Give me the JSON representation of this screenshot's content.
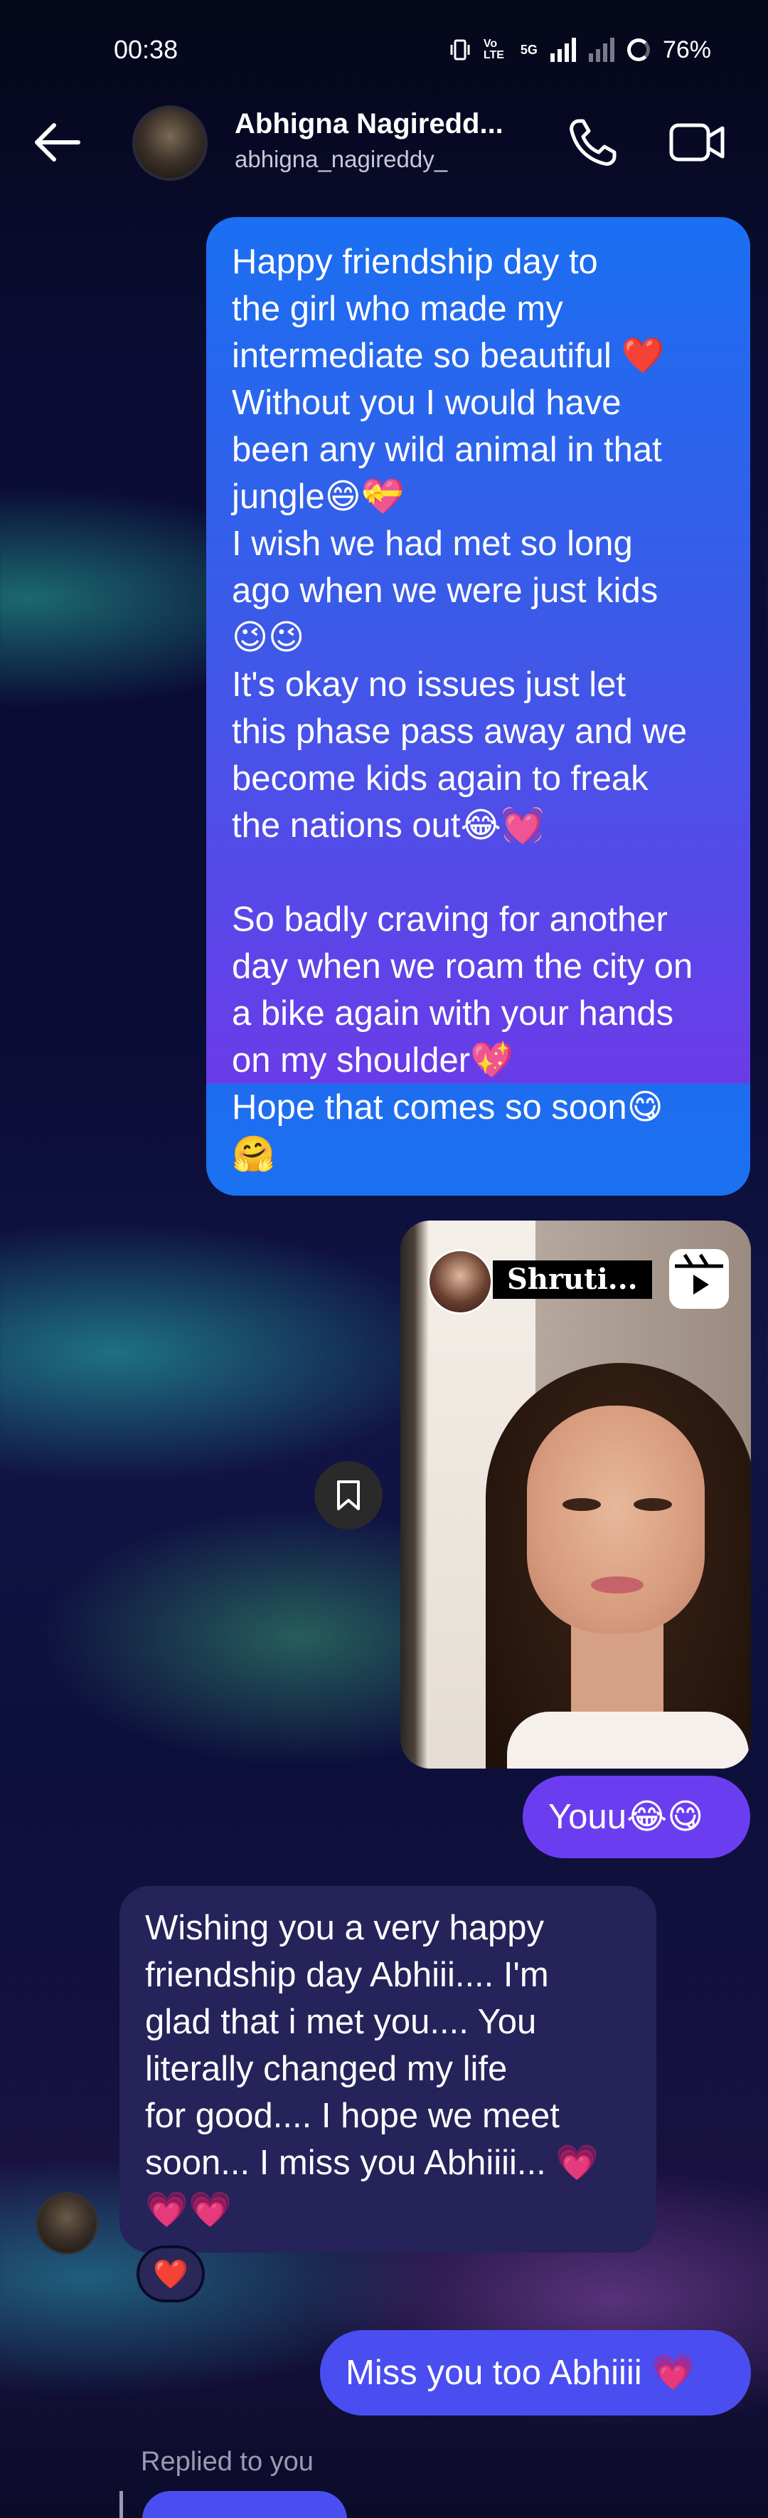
{
  "status_bar": {
    "time": "00:38",
    "volte_label": "Vo LTE",
    "network": "5G",
    "battery": "76%"
  },
  "header": {
    "name": "Abhigna Nagiredd...",
    "username": "abhigna_nagireddy_",
    "icons": [
      "back-arrow-icon",
      "phone-icon",
      "video-icon"
    ]
  },
  "messages": {
    "friendship_message": {
      "lines": [
        "Happy friendship day to",
        "the girl who made my",
        "intermediate so beautiful ❤️",
        "Without you I would have",
        "been any wild animal in that",
        "jungle😄💝",
        "I wish we had met so long",
        "ago when we were just kids",
        "😉😉",
        "It's okay no issues just let",
        "this phase pass away and we",
        "become kids again to freak",
        "the nations out😂💓",
        "So badly craving for another",
        "day when we roam the city on",
        "a bike again with your hands",
        "on my shoulder💖",
        "Hope that comes so soon😋",
        "🤗"
      ]
    },
    "reel": {
      "creator_name": "Shruti...",
      "icon": "reels-icon"
    },
    "youu": "Youu😂😋",
    "wishing_message": {
      "lines": [
        "Wishing you a very happy",
        "friendship day Abhiii.... I'm",
        "glad that i met you.... You",
        "literally changed my life",
        "for good.... I hope we meet",
        "soon... I miss you Abhiiii... 💗",
        "💗💗"
      ]
    },
    "reaction": "❤️",
    "miss_you": "Miss you too Abhiiii 💗",
    "replied_label": "Replied to you"
  },
  "colors": {
    "outgoing_blue": "#1a6ff2",
    "outgoing_purple": "#6a3ef0",
    "incoming_bubble": "#25235a"
  }
}
